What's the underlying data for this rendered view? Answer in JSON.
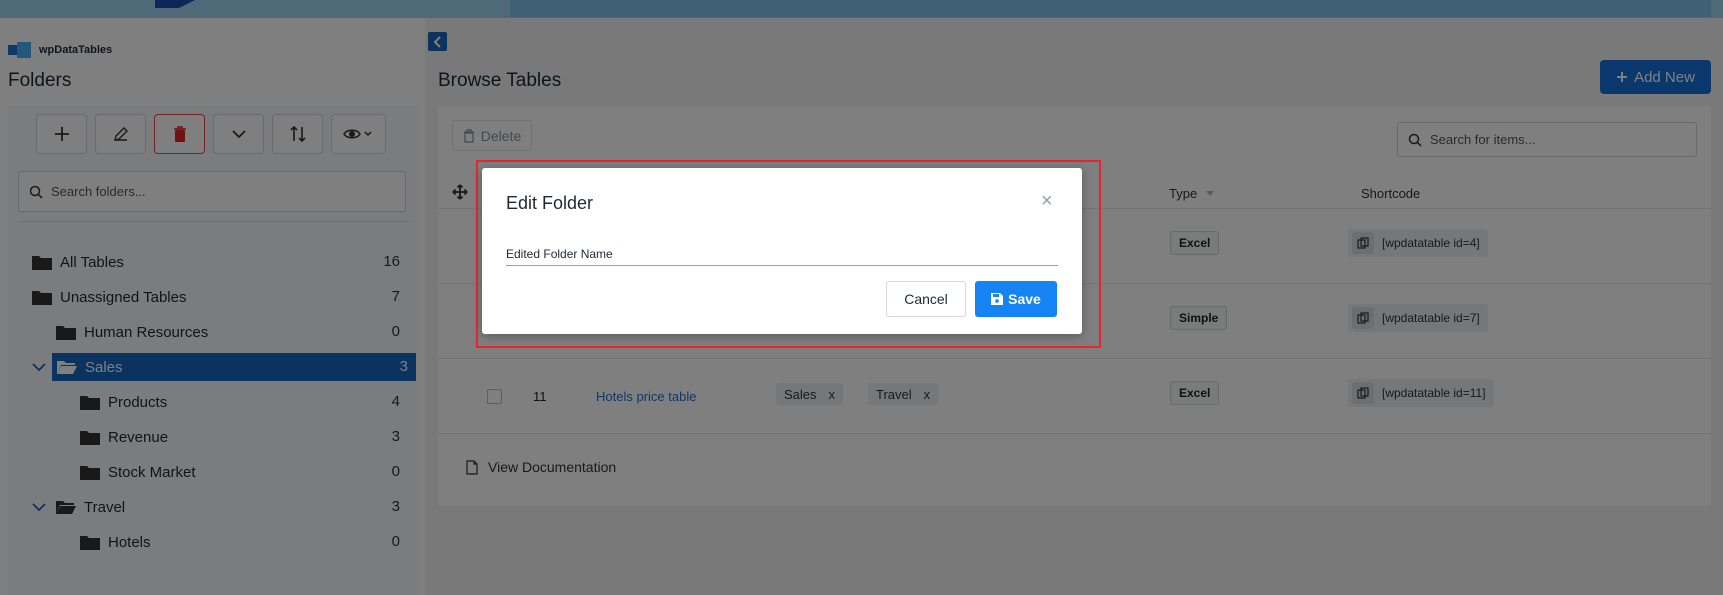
{
  "brand": {
    "name": "wpDataTables"
  },
  "sidebar": {
    "title": "Folders",
    "search_placeholder": "Search folders...",
    "toolbar": [
      {
        "name": "add-folder-button",
        "icon": "plus-icon"
      },
      {
        "name": "rename-folder-button",
        "icon": "pencil-icon"
      },
      {
        "name": "delete-folder-button",
        "icon": "trash-icon"
      },
      {
        "name": "expand-folders-button",
        "icon": "chevron-down-icon"
      },
      {
        "name": "sort-folders-button",
        "icon": "sort-icon"
      },
      {
        "name": "view-options-button",
        "icon": "eye-icon"
      }
    ],
    "items": [
      {
        "label": "All Tables",
        "count": "16"
      },
      {
        "label": "Unassigned Tables",
        "count": "7"
      },
      {
        "label": "Human Resources",
        "count": "0"
      },
      {
        "label": "Sales",
        "count": "3",
        "selected": true
      },
      {
        "label": "Products",
        "count": "4"
      },
      {
        "label": "Revenue",
        "count": "3"
      },
      {
        "label": "Stock Market",
        "count": "0"
      },
      {
        "label": "Travel",
        "count": "3"
      },
      {
        "label": "Hotels",
        "count": "0"
      }
    ]
  },
  "main": {
    "title": "Browse Tables",
    "add_new_label": "Add New",
    "delete_label": "Delete",
    "search_placeholder": "Search for items...",
    "columns": {
      "type": "Type",
      "shortcode": "Shortcode"
    },
    "rows": [
      {
        "type": "Excel",
        "shortcode": "[wpdatatable id=4]"
      },
      {
        "type": "Simple",
        "shortcode": "[wpdatatable id=7]"
      },
      {
        "id": "11",
        "name": "Hotels price table",
        "tags": [
          "Sales",
          "Travel"
        ],
        "tag_remove": "x",
        "type": "Excel",
        "shortcode": "[wpdatatable id=11]"
      }
    ],
    "doc_link": "View Documentation"
  },
  "modal": {
    "title": "Edit Folder",
    "close": "×",
    "input_value": "Edited Folder Name",
    "cancel_label": "Cancel",
    "save_label": "Save"
  },
  "colors": {
    "accent": "#1667c0",
    "primary_button": "#1683f5",
    "highlight": "#e8252e"
  }
}
